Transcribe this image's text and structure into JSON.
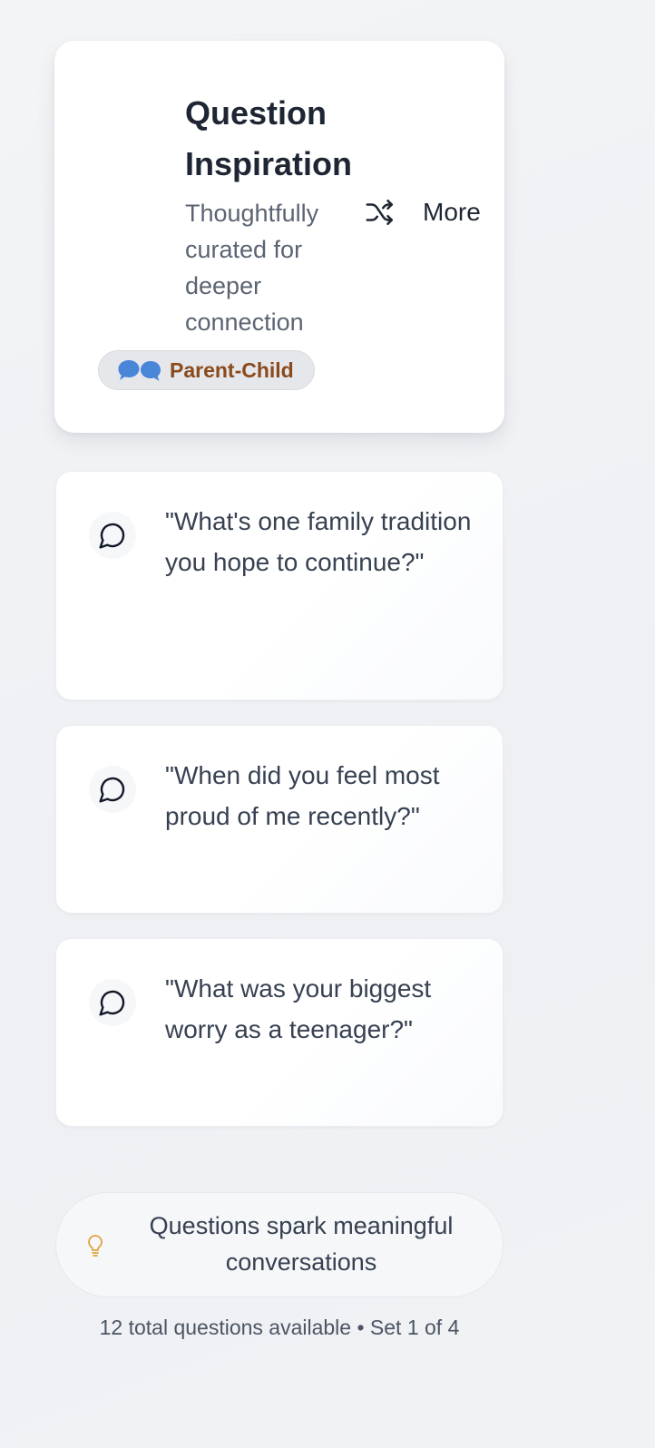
{
  "header": {
    "title": "Question Inspiration",
    "subtitle": "Thoughtfully curated for deeper connection",
    "more_button": {
      "icon": "shuffle-icon",
      "label": "More"
    },
    "category_badge": {
      "icon": "speech-bubbles-icon",
      "label": "Parent-Child",
      "icon_color": "#4a86d8",
      "text_color": "#8b4a1c"
    }
  },
  "questions": [
    {
      "icon": "chat-bubble-icon",
      "text": "\"What's one family tradition you hope to continue?\""
    },
    {
      "icon": "chat-bubble-icon",
      "text": "\"When did you feel most proud of me recently?\""
    },
    {
      "icon": "chat-bubble-icon",
      "text": "\"What was your biggest worry as a teenager?\""
    }
  ],
  "tip": {
    "icon": "lightbulb-icon",
    "icon_color": "#e0a33a",
    "text": "Questions spark meaningful conversations"
  },
  "footer": {
    "text": "12 total questions available • Set 1 of 4"
  }
}
